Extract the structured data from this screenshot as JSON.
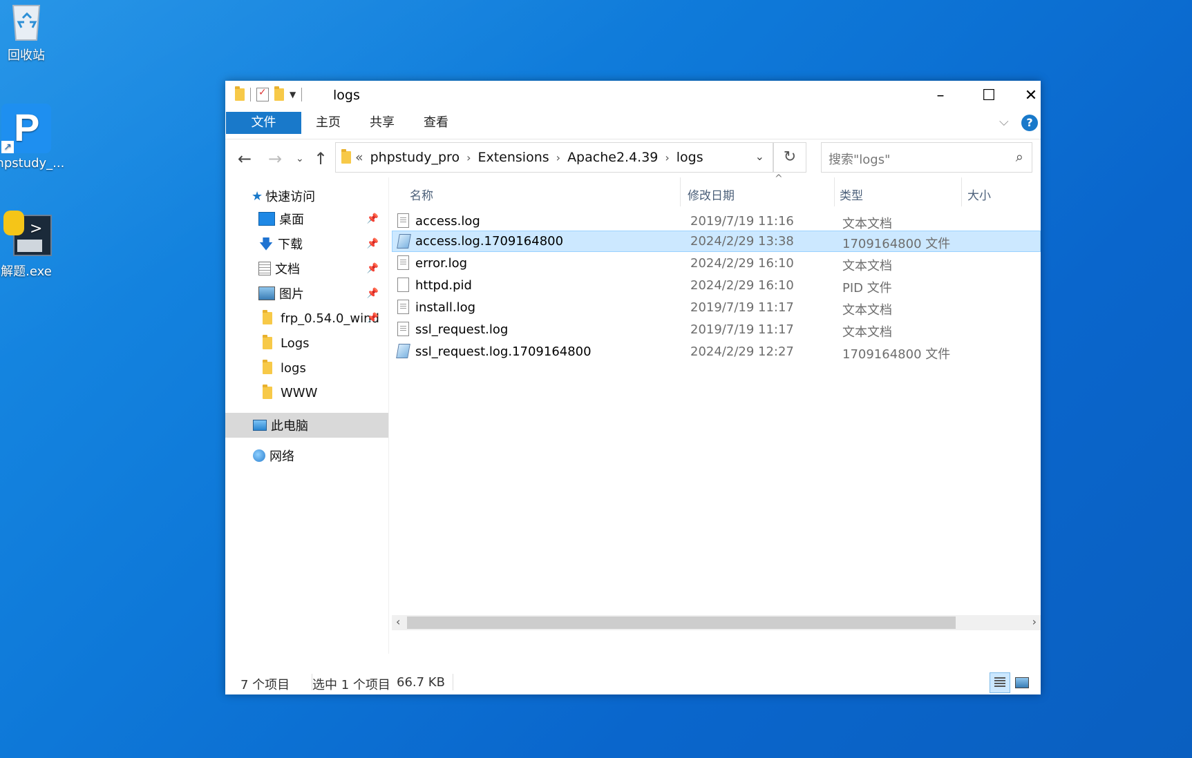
{
  "desktop": {
    "icons": [
      {
        "label": "回收站",
        "icon": "recycle-bin-icon"
      },
      {
        "label": "phpstudy_...",
        "icon": "phpstudy-icon"
      },
      {
        "label": "解题.exe",
        "icon": "python-exe-icon"
      }
    ]
  },
  "window": {
    "title": "logs",
    "controls": {
      "minimize": "–",
      "maximize": "☐",
      "close": "✕"
    }
  },
  "ribbon": {
    "tabs": [
      "文件",
      "主页",
      "共享",
      "查看"
    ],
    "help": "?"
  },
  "address": {
    "prefix": "«",
    "crumbs": [
      "phpstudy_pro",
      "Extensions",
      "Apache2.4.39",
      "logs"
    ],
    "search_placeholder": "搜索\"logs\""
  },
  "nav": {
    "quick_access": "快速访问",
    "items": [
      {
        "label": "桌面",
        "pinned": true
      },
      {
        "label": "下载",
        "pinned": true
      },
      {
        "label": "文档",
        "pinned": true
      },
      {
        "label": "图片",
        "pinned": true
      },
      {
        "label": "frp_0.54.0_wind",
        "pinned": true
      },
      {
        "label": "Logs",
        "pinned": false
      },
      {
        "label": "logs",
        "pinned": false
      },
      {
        "label": "WWW",
        "pinned": false
      }
    ],
    "this_pc": "此电脑",
    "network": "网络"
  },
  "columns": {
    "name": "名称",
    "modified": "修改日期",
    "type": "类型",
    "size": "大小"
  },
  "files": [
    {
      "name": "access.log",
      "modified": "2019/7/19 11:16",
      "type": "文本文档",
      "icon": "text-file-icon"
    },
    {
      "name": "access.log.1709164800",
      "modified": "2024/2/29 13:38",
      "type": "1709164800 文件",
      "icon": "generic-file-icon",
      "selected": true
    },
    {
      "name": "error.log",
      "modified": "2024/2/29 16:10",
      "type": "文本文档",
      "icon": "text-file-icon"
    },
    {
      "name": "httpd.pid",
      "modified": "2024/2/29 16:10",
      "type": "PID 文件",
      "icon": "blank-file-icon"
    },
    {
      "name": "install.log",
      "modified": "2019/7/19 11:17",
      "type": "文本文档",
      "icon": "text-file-icon"
    },
    {
      "name": "ssl_request.log",
      "modified": "2019/7/19 11:17",
      "type": "文本文档",
      "icon": "text-file-icon"
    },
    {
      "name": "ssl_request.log.1709164800",
      "modified": "2024/2/29 12:27",
      "type": "1709164800 文件",
      "icon": "generic-file-icon"
    }
  ],
  "status": {
    "count": "7 个项目",
    "selection": "选中 1 个项目",
    "size": "66.7 KB"
  }
}
